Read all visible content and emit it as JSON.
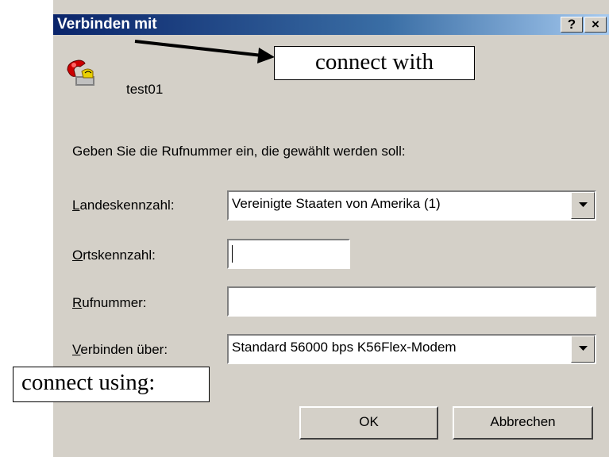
{
  "window": {
    "title": "Verbinden mit",
    "help_button": "?",
    "close_button": "×"
  },
  "connection": {
    "name": "test01",
    "icon": "phone-icon"
  },
  "instruction": "Geben Sie die Rufnummer ein, die gewählt werden soll:",
  "fields": {
    "country_code": {
      "label_first": "L",
      "label_rest": "andeskennzahl:",
      "value": "Vereinigte Staaten von Amerika (1)"
    },
    "area_code": {
      "label_first": "O",
      "label_rest": "rtskennzahl:",
      "value": ""
    },
    "phone_number": {
      "label_first": "R",
      "label_rest": "ufnummer:",
      "value": ""
    },
    "connect_using": {
      "label_first": "V",
      "label_rest": "erbinden über:",
      "value": "Standard 56000 bps K56Flex-Modem"
    }
  },
  "buttons": {
    "ok": "OK",
    "cancel": "Abbrechen"
  },
  "annotations": {
    "title_callout": "connect with",
    "connect_callout": "connect using:"
  }
}
